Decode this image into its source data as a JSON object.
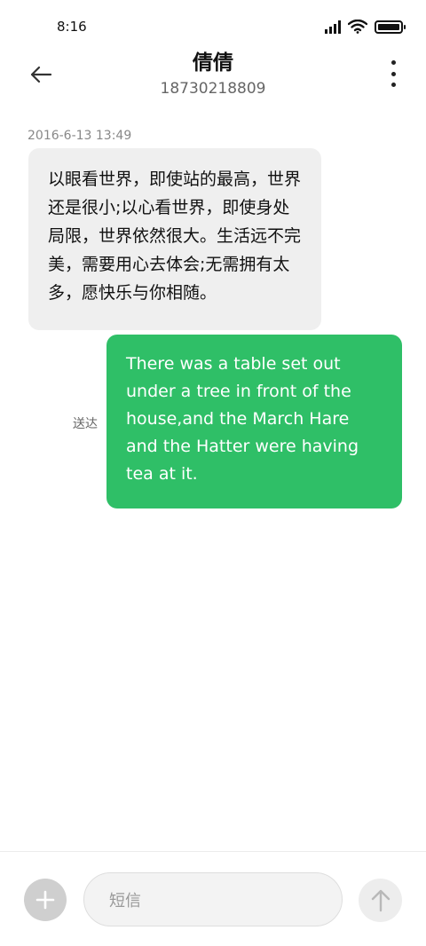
{
  "status_bar": {
    "time": "8:16",
    "icons": [
      "signal-icon",
      "wifi-icon",
      "battery-icon"
    ]
  },
  "header": {
    "back_icon": "arrow-left-icon",
    "contact_name": "倩倩",
    "contact_number": "18730218809",
    "more_icon": "more-vertical-icon"
  },
  "conversation": {
    "timestamp": "2016-6-13 13:49",
    "messages": [
      {
        "direction": "incoming",
        "text": "以眼看世界，即使站的最高，世界还是很小;以心看世界，即使身处局限，世界依然很大。生活远不完美，需要用心去体会;无需拥有太多，愿快乐与你相随。"
      },
      {
        "direction": "outgoing",
        "text": "There was a table set out under a tree in front of the house,and the March Hare and the Hatter were having tea at it.",
        "status": "送达"
      }
    ]
  },
  "composer": {
    "add_icon": "plus-icon",
    "placeholder": "短信",
    "send_icon": "arrow-up-icon"
  },
  "colors": {
    "outgoing_bubble": "#2fbf67",
    "incoming_bubble": "#efefef",
    "background": "#ffffff"
  }
}
